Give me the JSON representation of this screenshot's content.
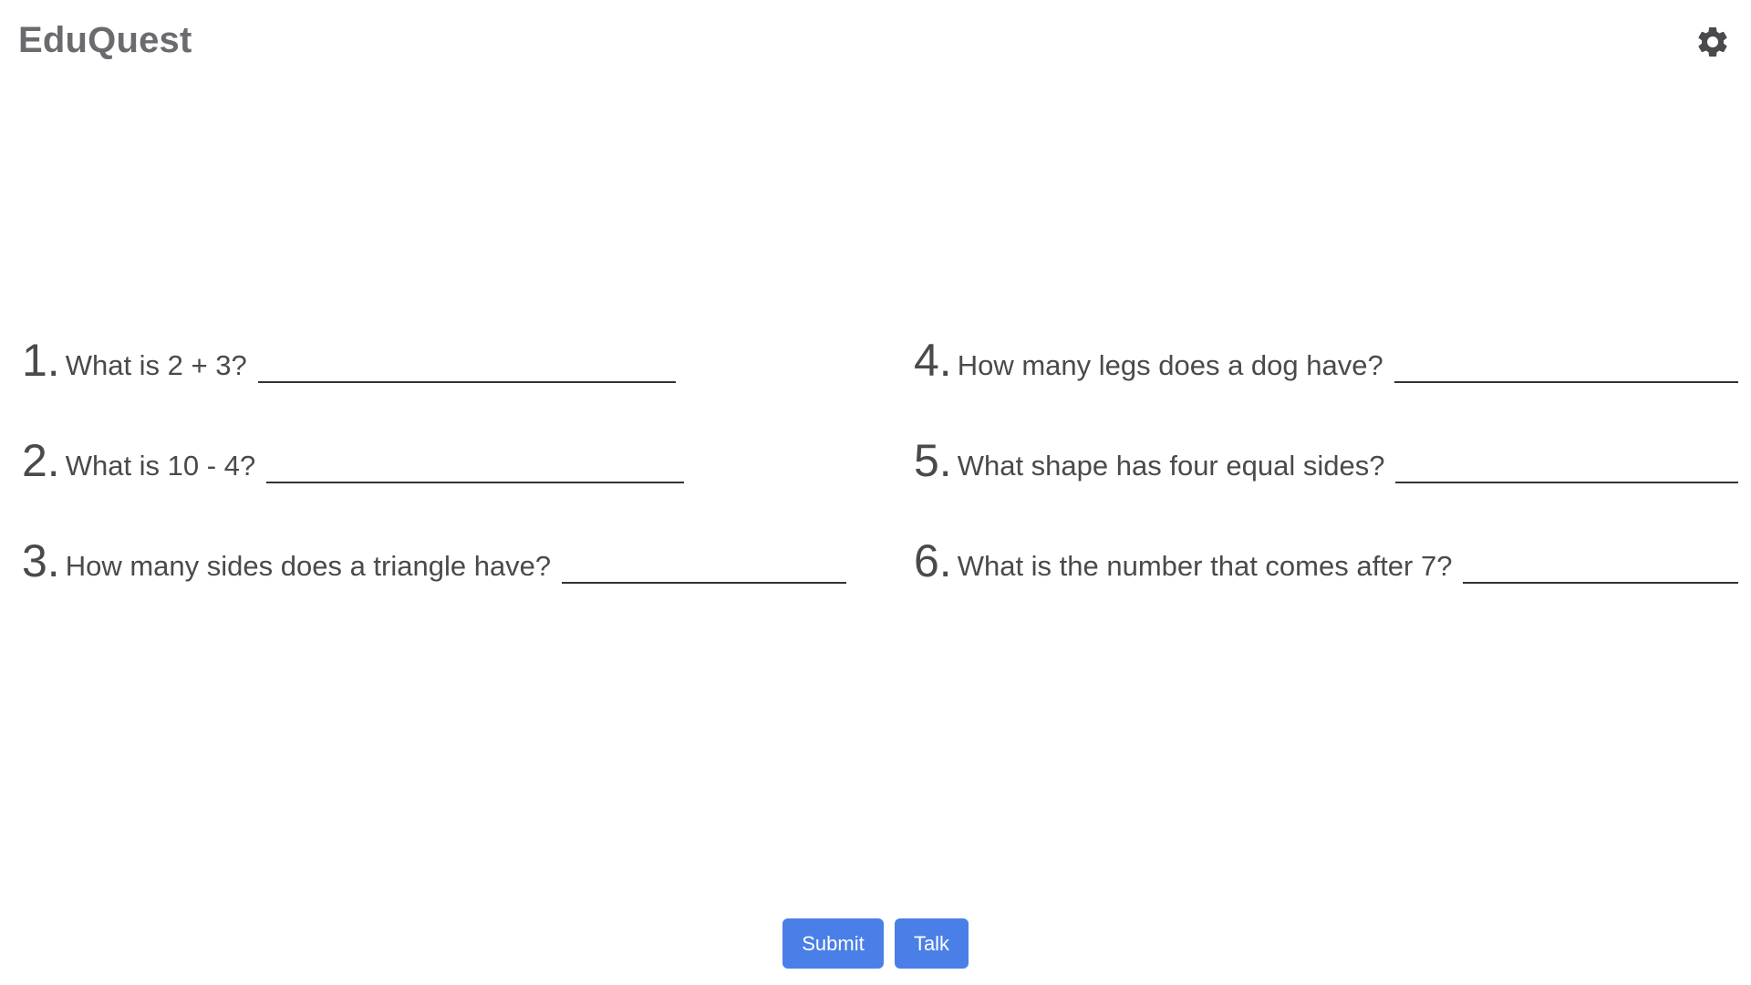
{
  "app": {
    "title": "EduQuest",
    "settings_icon": "gear-icon"
  },
  "questions": [
    {
      "number": "1.",
      "text": "What is 2 + 3?",
      "answer": ""
    },
    {
      "number": "2.",
      "text": "What is 10 - 4?",
      "answer": ""
    },
    {
      "number": "3.",
      "text": "How many sides does a triangle have?",
      "answer": ""
    },
    {
      "number": "4.",
      "text": "How many legs does a dog have?",
      "answer": ""
    },
    {
      "number": "5.",
      "text": "What shape has four equal sides?",
      "answer": ""
    },
    {
      "number": "6.",
      "text": "What is the number that comes after 7?",
      "answer": ""
    }
  ],
  "actions": {
    "submit_label": "Submit",
    "talk_label": "Talk"
  },
  "colors": {
    "accent": "#4a7fe8",
    "brand_text": "#6b6b6f",
    "body_text": "#4a4a4a"
  }
}
